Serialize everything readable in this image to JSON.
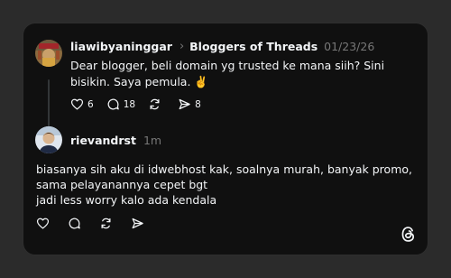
{
  "post": {
    "username": "liawibyaninggar",
    "community": "Bloggers of Threads",
    "timestamp": "01/23/26",
    "text": "Dear blogger, beli domain yg trusted ke mana siih? Sini bisikin. Saya pemula. ✌️",
    "likes": "6",
    "replies": "18",
    "reposts": "",
    "shares": "8"
  },
  "reply": {
    "username": "rievandrst",
    "timestamp": "1m",
    "lines": [
      "biasanya sih aku di idwebhost kak, soalnya murah, banyak promo, sama pelayanannya cepet bgt",
      "jadi less worry kalo ada kendala"
    ]
  },
  "icons": {
    "like": "heart-icon",
    "reply": "comment-icon",
    "repost": "repost-icon",
    "share": "send-icon",
    "brand": "threads-logo"
  },
  "colors": {
    "background": "#2b2b2b",
    "card": "#101010",
    "text": "#f3f5f7",
    "muted": "#777777"
  }
}
